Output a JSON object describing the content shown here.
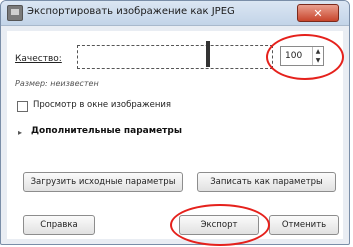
{
  "window": {
    "title": "Экспортировать изображение как JPEG",
    "close_label": "✕"
  },
  "quality": {
    "label": "Качество:",
    "value": "100"
  },
  "file_size_label": "Размер: неизвестен",
  "preview_checkbox": {
    "label": "Просмотр в окне изображения",
    "checked": false
  },
  "advanced": {
    "label": "Дополнительные параметры",
    "expanded": false
  },
  "buttons": {
    "load_defaults": "Загрузить исходные параметры",
    "save_defaults": "Записать как параметры",
    "help": "Справка",
    "export": "Экспорт",
    "cancel": "Отменить"
  },
  "colors": {
    "annotation": "#e5211c"
  }
}
